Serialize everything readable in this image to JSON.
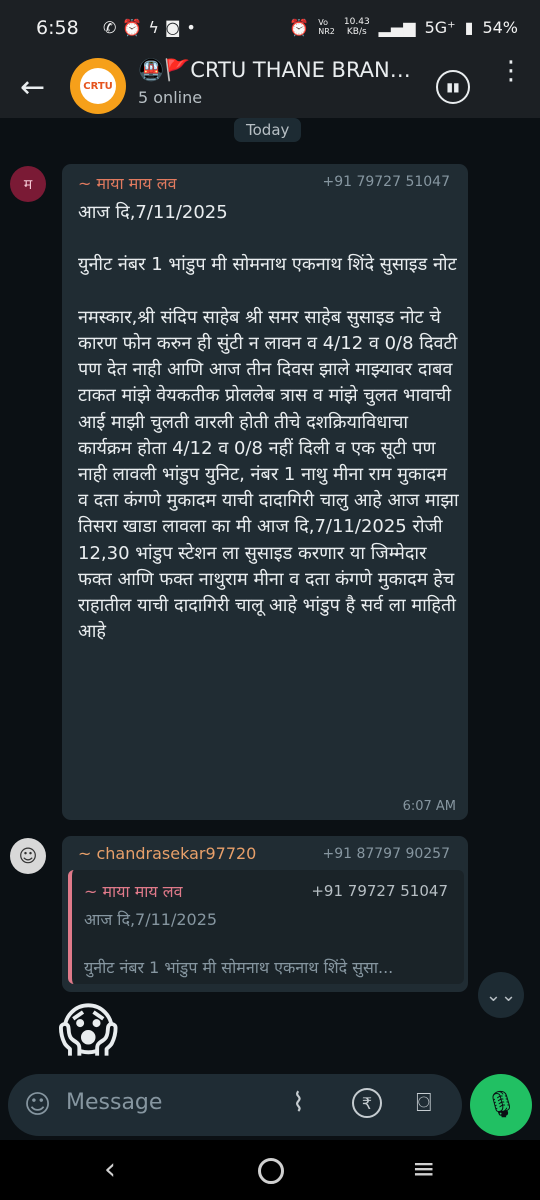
{
  "status_bar": {
    "time": "6:58",
    "notif_icons": [
      "whatsapp-icon",
      "alarm-icon",
      "bolt-icon",
      "instagram-icon",
      "dot-icon"
    ],
    "net_speed": "10.43\nKB/s",
    "volte": "Vo\nNR2",
    "network": "5G⁺",
    "battery": "54%"
  },
  "header": {
    "title": "🚇🚩CRTU THANE BRAN…",
    "subtitle": "5 online",
    "avatar_text": "CRTU"
  },
  "date_chip": "Today",
  "messages": [
    {
      "avatar_initial": "म",
      "sender": "~ माया माय लव",
      "phone": "+91 79727 51047",
      "text": "आज दि,7/11/2025\n\nयुनीट नंबर 1 भांडुप मी सोमनाथ एकनाथ शिंदे सुसाइड नोट\n\nनमस्कार,श्री संदिप साहेब श्री समर साहेब सुसाइड नोट चे कारण फोन करुन ही सुंटी न लावन व 4/12 व 0/8 दिवटी पण देत नाही आणि आज तीन दिवस झाले माझ्यावर दाबव टाकत मांझे वेयकतीक प्रोललेब त्रास व मांझे चुलत भावाची आई माझी चुलती वारली होती तीचे दशक्रियाविधाचा कार्यक्रम होता 4/12 व 0/8 नहीं दिली व एक सूटी पण नाही लावली भांडुप युनिट, नंबर 1 नाथु मीना राम मुकादम व दता कंगणे मुकादम याची दादागिरी चालु आहे आज माझा तिसरा खाडा लावला का मी आज दि,7/11/2025 रोजी 12,30 भांडुप स्टेशन ला सुसाइड करणार या जिम्मेदार फक्त आणि फक्त नाथुराम मीना व दता कंगणे मुकादम हेच राहातील याची दादागिरी चालू आहे भांडुप है सर्व ला माहिती आहे",
      "time": "6:07 AM"
    },
    {
      "sender": "~ chandrasekar97720",
      "phone": "+91 87797 90257",
      "quote": {
        "sender": "~ माया माय लव",
        "phone": "+91 79727 51047",
        "line1": "आज दि,7/11/2025",
        "line2": "युनीट नंबर 1 भांडुप मी सोमनाथ एकनाथ शिंदे सुसा..."
      }
    }
  ],
  "reaction_emoji": "😱",
  "input": {
    "placeholder": "Message"
  },
  "colors": {
    "accent_green": "#21c063",
    "bubble": "#202c33",
    "bg": "#0b1014"
  }
}
